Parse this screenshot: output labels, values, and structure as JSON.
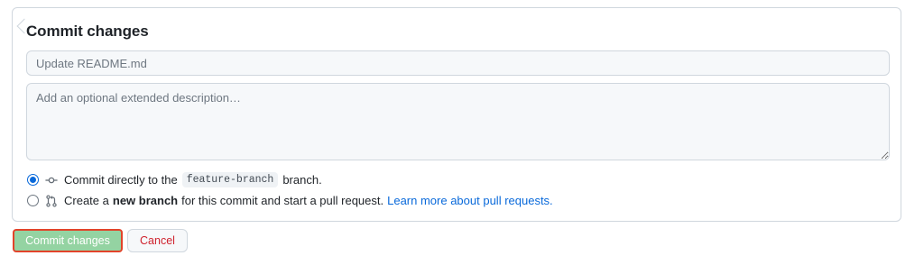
{
  "commit_form": {
    "title": "Commit changes",
    "summary": {
      "value": "",
      "placeholder": "Update README.md"
    },
    "description": {
      "value": "",
      "placeholder": "Add an optional extended description…"
    },
    "options": {
      "direct": {
        "selected": true,
        "icon": "git-commit-icon",
        "prefix": "Commit directly to the",
        "branch": "feature-branch",
        "suffix": "branch."
      },
      "new_branch": {
        "selected": false,
        "icon": "git-pull-request-icon",
        "prefix": "Create a",
        "bold": "new branch",
        "suffix": "for this commit and start a pull request.",
        "link": "Learn more about pull requests."
      }
    }
  },
  "actions": {
    "commit_label": "Commit changes",
    "cancel_label": "Cancel"
  },
  "colors": {
    "primary_green": "#94d3a2",
    "danger_red": "#cf222e",
    "link_blue": "#0969da",
    "highlight_border": "#e2432a"
  }
}
